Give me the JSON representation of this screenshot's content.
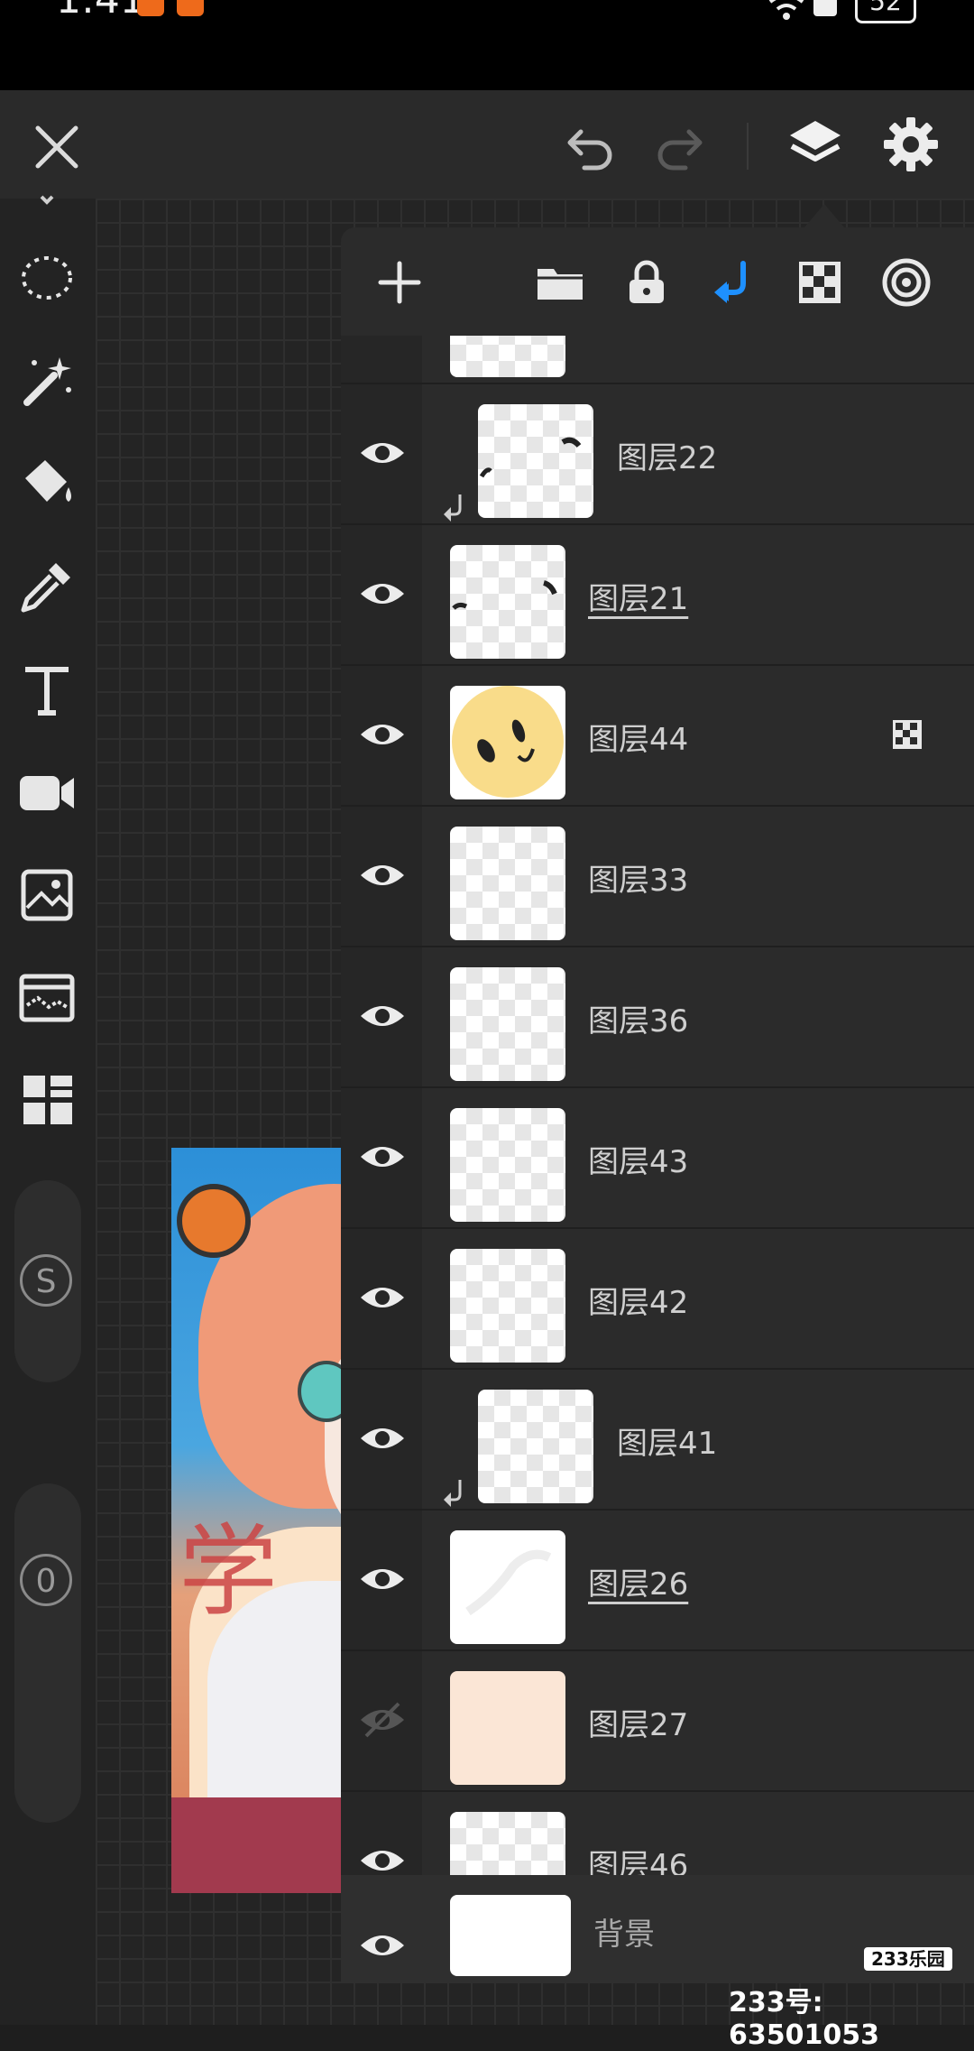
{
  "status_bar": {
    "time": "1:41",
    "battery": "52"
  },
  "layers_panel": {
    "layers": [
      {
        "name": "",
        "visible": true,
        "indented": false,
        "underlined": false
      },
      {
        "name": "图层22",
        "visible": true,
        "indented": true,
        "underlined": false
      },
      {
        "name": "图层21",
        "visible": true,
        "indented": false,
        "underlined": true
      },
      {
        "name": "图层44",
        "visible": true,
        "indented": false,
        "underlined": false,
        "alpha_lock": true
      },
      {
        "name": "图层33",
        "visible": true,
        "indented": false,
        "underlined": false
      },
      {
        "name": "图层36",
        "visible": true,
        "indented": false,
        "underlined": false
      },
      {
        "name": "图层43",
        "visible": true,
        "indented": false,
        "underlined": false
      },
      {
        "name": "图层42",
        "visible": true,
        "indented": false,
        "underlined": false
      },
      {
        "name": "图层41",
        "visible": true,
        "indented": true,
        "underlined": false
      },
      {
        "name": "图层26",
        "visible": true,
        "indented": false,
        "underlined": true
      },
      {
        "name": "图层27",
        "visible": false,
        "indented": false,
        "underlined": false
      },
      {
        "name": "图层46",
        "visible": true,
        "indented": false,
        "underlined": false
      }
    ],
    "background_layer": {
      "name": "背景"
    }
  },
  "slider_labels": {
    "size": "S",
    "opacity": "0"
  },
  "watermark": {
    "logo": "233乐园",
    "id": "233号: 63501053"
  },
  "colors": {
    "accent": "#1e90ff",
    "panel": "#2b2b2b",
    "toolbar": "#2a2a2a"
  }
}
